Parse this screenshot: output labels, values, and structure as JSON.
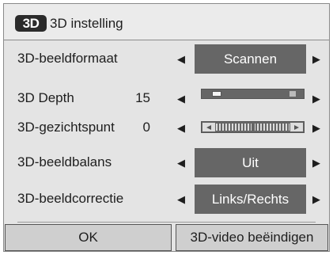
{
  "dialog": {
    "badge": "3D",
    "title": "3D instelling"
  },
  "rows": [
    {
      "label": "3D-beeldformaat",
      "value": "Scannen"
    },
    {
      "label": "3D Depth",
      "number": "15",
      "slider_level_percent": 10
    },
    {
      "label": "3D-gezichtspunt",
      "number": "0"
    },
    {
      "label": "3D-beeldbalans",
      "value": "Uit"
    },
    {
      "label": "3D-beeldcorrectie",
      "value": "Links/Rechts"
    }
  ],
  "arrows": {
    "left": "◀",
    "right": "▶"
  },
  "buttons": {
    "ok": "OK",
    "end": "3D-video beëindigen"
  },
  "colors": {
    "value_box": "#666666",
    "background": "#e4e4e4"
  }
}
